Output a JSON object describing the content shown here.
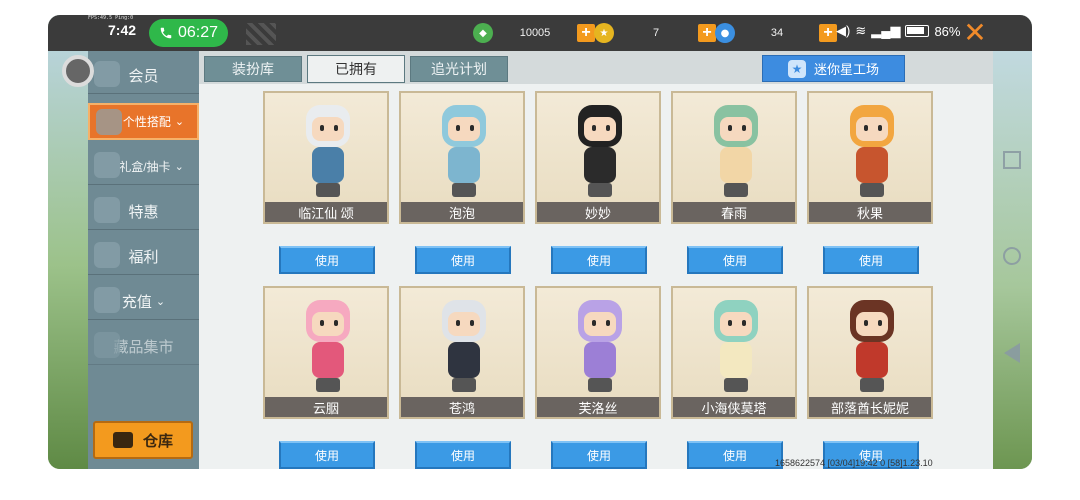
{
  "status_bar": {
    "fps_text": "FPS:49.5  Ping:0",
    "time_small": "7:42",
    "call_time": "06:27",
    "battery": "86%"
  },
  "currencies": [
    {
      "icon": "green-gem-icon",
      "value": "10005",
      "color": "#4caf50"
    },
    {
      "icon": "gold-coin-icon",
      "value": "7",
      "color": "#e6b520"
    },
    {
      "icon": "blue-coin-icon",
      "value": "34",
      "color": "#3b8fe0"
    }
  ],
  "plus_label": "+",
  "sidebar": {
    "items": [
      {
        "label": "会员",
        "chevron": ""
      },
      {
        "label": "个性搭配",
        "chevron": "⌄"
      },
      {
        "label": "礼盒/抽卡",
        "chevron": "⌄"
      },
      {
        "label": "特惠",
        "chevron": ""
      },
      {
        "label": "福利",
        "chevron": ""
      },
      {
        "label": "充值",
        "chevron": "⌄"
      },
      {
        "label": "藏品集市",
        "chevron": ""
      }
    ],
    "warehouse_label": "仓库"
  },
  "tabs": [
    {
      "label": "装扮库"
    },
    {
      "label": "已拥有"
    },
    {
      "label": "追光计划"
    }
  ],
  "workshop_label": "迷你星工场",
  "use_label": "使用",
  "skins": [
    {
      "name": "临江仙 颂",
      "hair": "#e9ecef",
      "outfit": "#4a7fa8"
    },
    {
      "name": "泡泡",
      "hair": "#8fc9dc",
      "outfit": "#7db5cf"
    },
    {
      "name": "妙妙",
      "hair": "#222222",
      "outfit": "#2b2b2b"
    },
    {
      "name": "春雨",
      "hair": "#89c2a1",
      "outfit": "#f2d6a6"
    },
    {
      "name": "秋果",
      "hair": "#f2a640",
      "outfit": "#c7552e"
    },
    {
      "name": "云胭",
      "hair": "#f6a9c0",
      "outfit": "#e3587b"
    },
    {
      "name": "苍鸿",
      "hair": "#dfe3e8",
      "outfit": "#2f3440"
    },
    {
      "name": "芙洛丝",
      "hair": "#b9a2e6",
      "outfit": "#9c7fd6"
    },
    {
      "name": "小海侠莫塔",
      "hair": "#8fd2c0",
      "outfit": "#f3e8c0"
    },
    {
      "name": "部落酋长妮妮",
      "hair": "#6b3424",
      "outfit": "#c0392b"
    }
  ],
  "footer": "1658622574 [03/04]19:42 0 [58]1.23.10"
}
